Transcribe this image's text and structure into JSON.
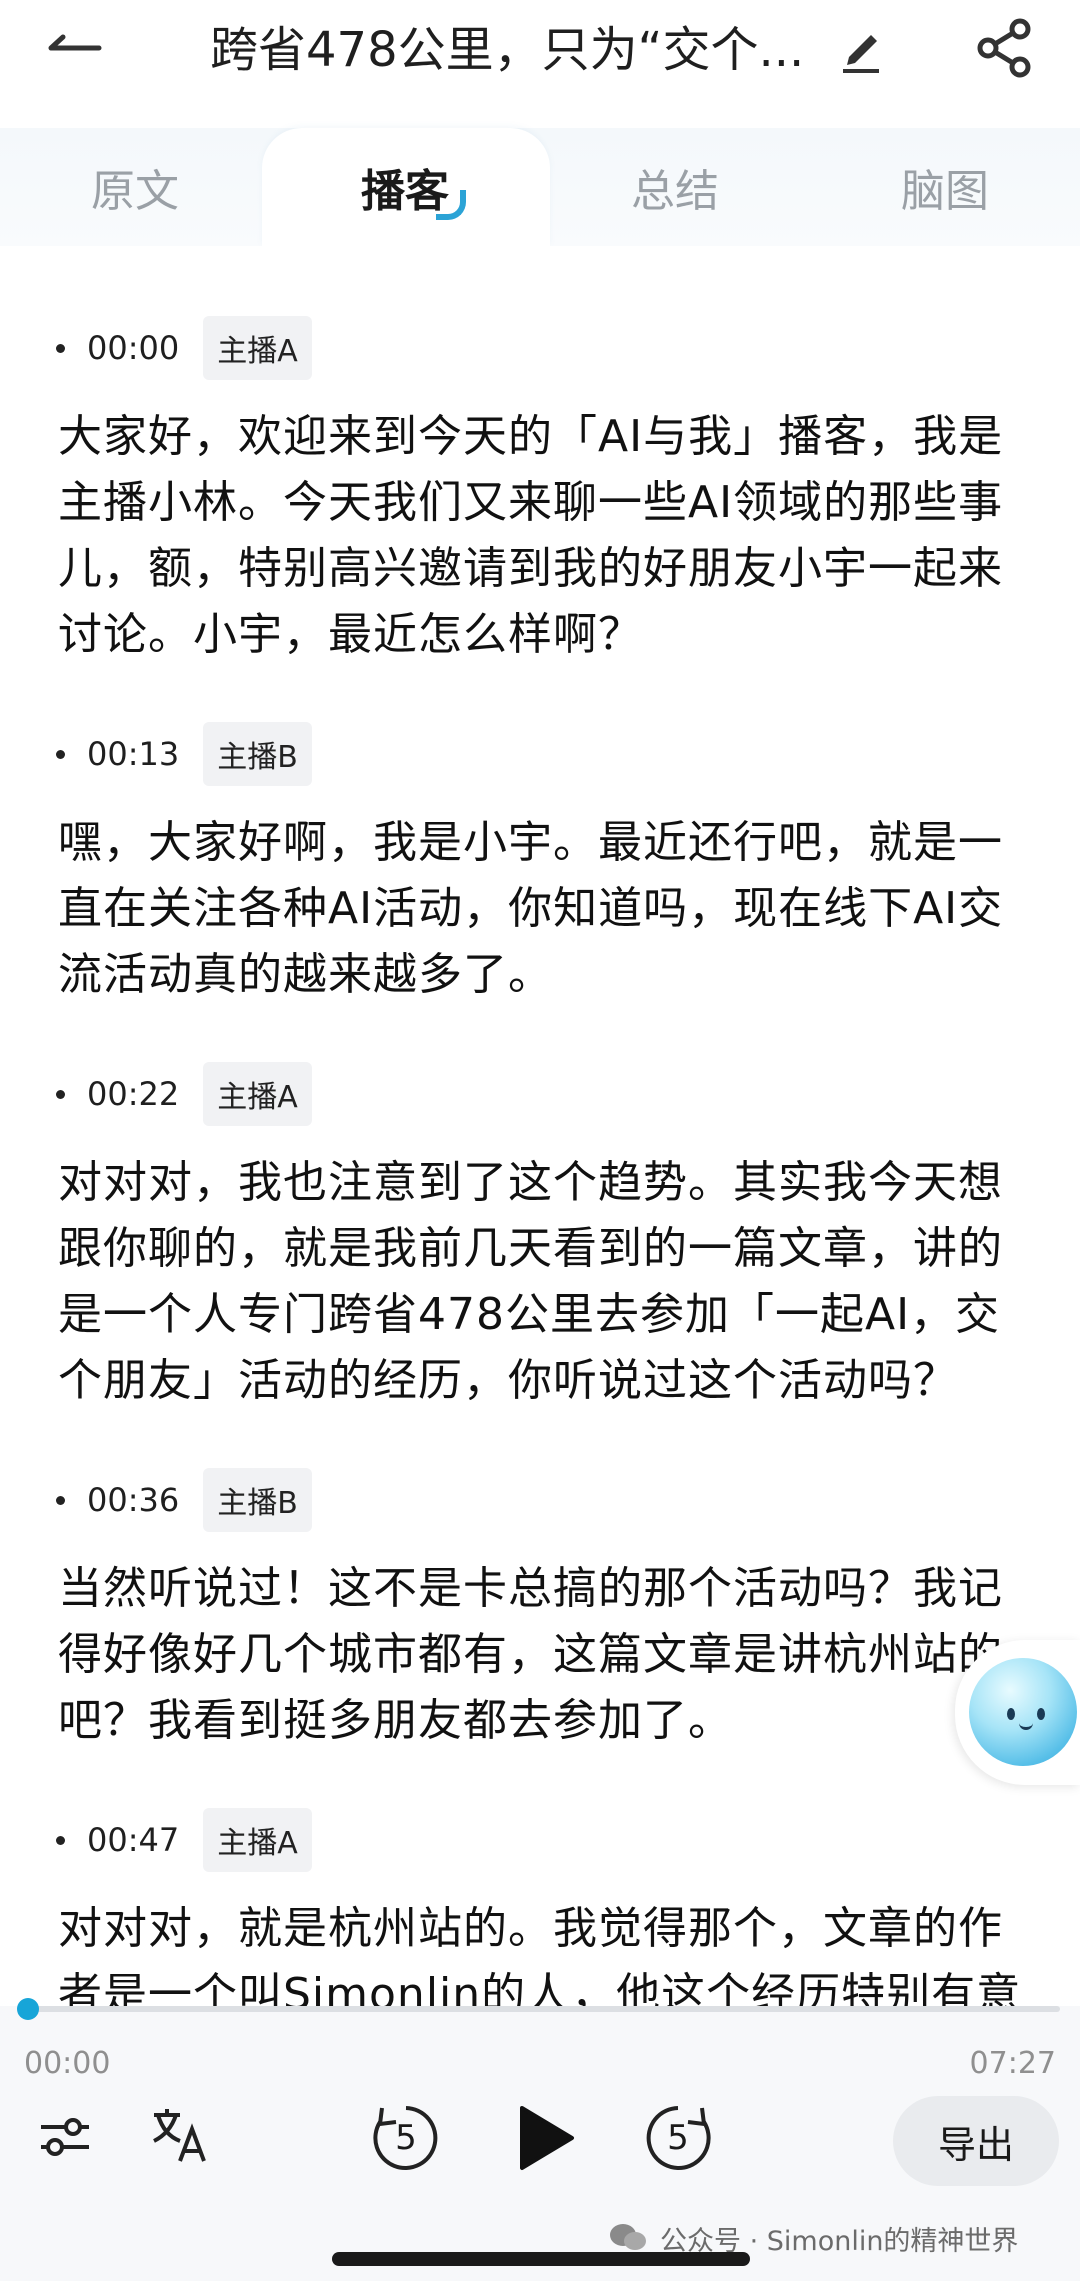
{
  "header": {
    "title": "跨省478公里，只为“交个...",
    "back_icon": "back-arrow-icon",
    "edit_icon": "pencil-icon",
    "share_icon": "share-icon"
  },
  "tabs": [
    {
      "label": "原文",
      "active": false
    },
    {
      "label": "播客",
      "active": true
    },
    {
      "label": "总结",
      "active": false
    },
    {
      "label": "脑图",
      "active": false
    }
  ],
  "segments": [
    {
      "time": "00:00",
      "speaker": "主播A",
      "lines": [
        "大家好，欢迎来到今天的「AI与我」播客，我是",
        "主播小林。今天我们又来聊一些AI领域的那些事",
        "儿，额，特别高兴邀请到我的好朋友小宇一起来",
        "讨论。小宇，最近怎么样啊？"
      ]
    },
    {
      "time": "00:13",
      "speaker": "主播B",
      "lines": [
        "嘿，大家好啊，我是小宇。最近还行吧，就是一",
        "直在关注各种AI活动，你知道吗，现在线下AI交",
        "流活动真的越来越多了。"
      ]
    },
    {
      "time": "00:22",
      "speaker": "主播A",
      "lines": [
        "对对对，我也注意到了这个趋势。其实我今天想",
        "跟你聊的，就是我前几天看到的一篇文章，讲的",
        "是一个人专门跨省478公里去参加「一起AI，交",
        "个朋友」活动的经历，你听说过这个活动吗？"
      ]
    },
    {
      "time": "00:36",
      "speaker": "主播B",
      "lines": [
        "当然听说过！这不是卡总搞的那个活动吗？我记",
        "得好像好几个城市都有，这篇文章是讲杭州站的",
        "吧？我看到挺多朋友都去参加了。"
      ]
    },
    {
      "time": "00:47",
      "speaker": "主播A",
      "lines": [
        "对对对，就是杭州站的。我觉得那个，文章的作",
        "者是一个叫Simonlin的人，他这个经历特别有意"
      ]
    }
  ],
  "player": {
    "current_time": "00:00",
    "total_time": "07:27",
    "progress": 0.0,
    "skip_back_seconds": "5",
    "skip_forward_seconds": "5",
    "export_label": "导出",
    "accent_color": "#2ba3d6"
  },
  "watermark": {
    "text": "公众号 · Simonlin的精神世界"
  }
}
